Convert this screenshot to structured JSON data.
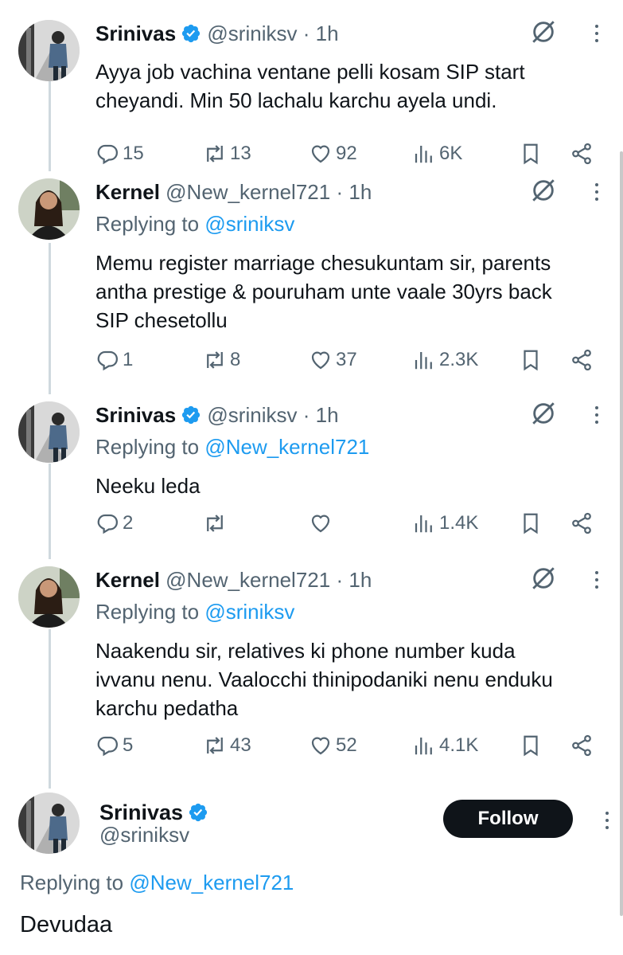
{
  "tweets": [
    {
      "name": "Srinivas",
      "verified": true,
      "handle": "@sriniksv",
      "time": "1h",
      "replying_to": "",
      "text_lines": [
        "Ayya job vachina ventane pelli kosam SIP start",
        "cheyandi. Min 50 lachalu karchu ayela undi."
      ],
      "replies": "15",
      "reposts": "13",
      "likes": "92",
      "views": "6K"
    },
    {
      "name": "Kernel",
      "verified": false,
      "handle": "@New_kernel721",
      "time": "1h",
      "replying_label": "Replying to",
      "replying_to": "@sriniksv",
      "text_lines": [
        "Memu register marriage chesukuntam sir, parents",
        "antha prestige & pouruham unte vaale 30yrs back",
        "SIP chesetollu"
      ],
      "replies": "1",
      "reposts": "8",
      "likes": "37",
      "views": "2.3K"
    },
    {
      "name": "Srinivas",
      "verified": true,
      "handle": "@sriniksv",
      "time": "1h",
      "replying_label": "Replying to",
      "replying_to": "@New_kernel721",
      "text_lines": [
        "Neeku leda"
      ],
      "replies": "2",
      "reposts": "",
      "likes": "",
      "views": "1.4K"
    },
    {
      "name": "Kernel",
      "verified": false,
      "handle": "@New_kernel721",
      "time": "1h",
      "replying_label": "Replying to",
      "replying_to": "@sriniksv",
      "text_lines": [
        "Naakendu sir, relatives ki phone number kuda",
        "ivvanu nenu. Vaalocchi thinipodaniki nenu enduku",
        "karchu pedatha"
      ],
      "replies": "5",
      "reposts": "43",
      "likes": "52",
      "views": "4.1K"
    }
  ],
  "main": {
    "name": "Srinivas",
    "handle": "@sriniksv",
    "follow_label": "Follow",
    "replying_label": "Replying to",
    "replying_to": "@New_kernel721",
    "text": "Devudaa"
  },
  "colors": {
    "accent": "#1d9bf0",
    "muted": "#536471",
    "text": "#0f1419",
    "thread_line": "#cfd9de"
  },
  "separator": "·"
}
